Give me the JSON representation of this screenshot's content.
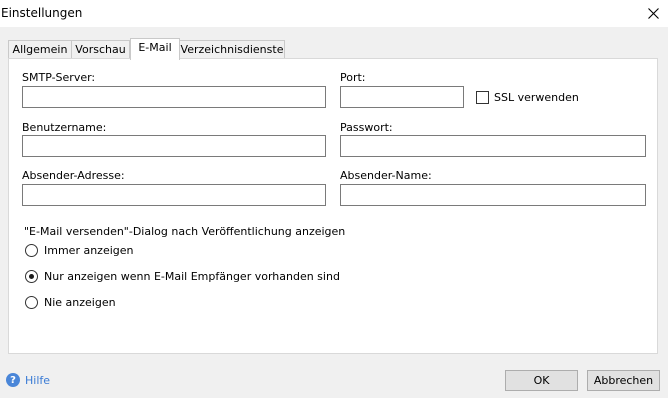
{
  "window": {
    "title": "Einstellungen"
  },
  "tabs": [
    {
      "label": "Allgemein"
    },
    {
      "label": "Vorschau"
    },
    {
      "label": "E-Mail"
    },
    {
      "label": "Verzeichnisdienste"
    }
  ],
  "email": {
    "smtp_server_label": "SMTP-Server:",
    "smtp_server_value": "",
    "port_label": "Port:",
    "port_value": "",
    "ssl_label": "SSL verwenden",
    "ssl_checked": false,
    "username_label": "Benutzername:",
    "username_value": "",
    "password_label": "Passwort:",
    "password_value": "",
    "sender_address_label": "Absender-Adresse:",
    "sender_address_value": "",
    "sender_name_label": "Absender-Name:",
    "sender_name_value": "",
    "dialog_group_label": "\"E-Mail versenden\"-Dialog nach Veröffentlichung anzeigen",
    "dialog_options": [
      {
        "label": "Immer anzeigen",
        "checked": false
      },
      {
        "label": "Nur anzeigen wenn E-Mail Empfänger vorhanden sind",
        "checked": true
      },
      {
        "label": "Nie anzeigen",
        "checked": false
      }
    ]
  },
  "footer": {
    "help_label": "Hilfe",
    "ok_label": "OK",
    "cancel_label": "Abbrechen"
  }
}
